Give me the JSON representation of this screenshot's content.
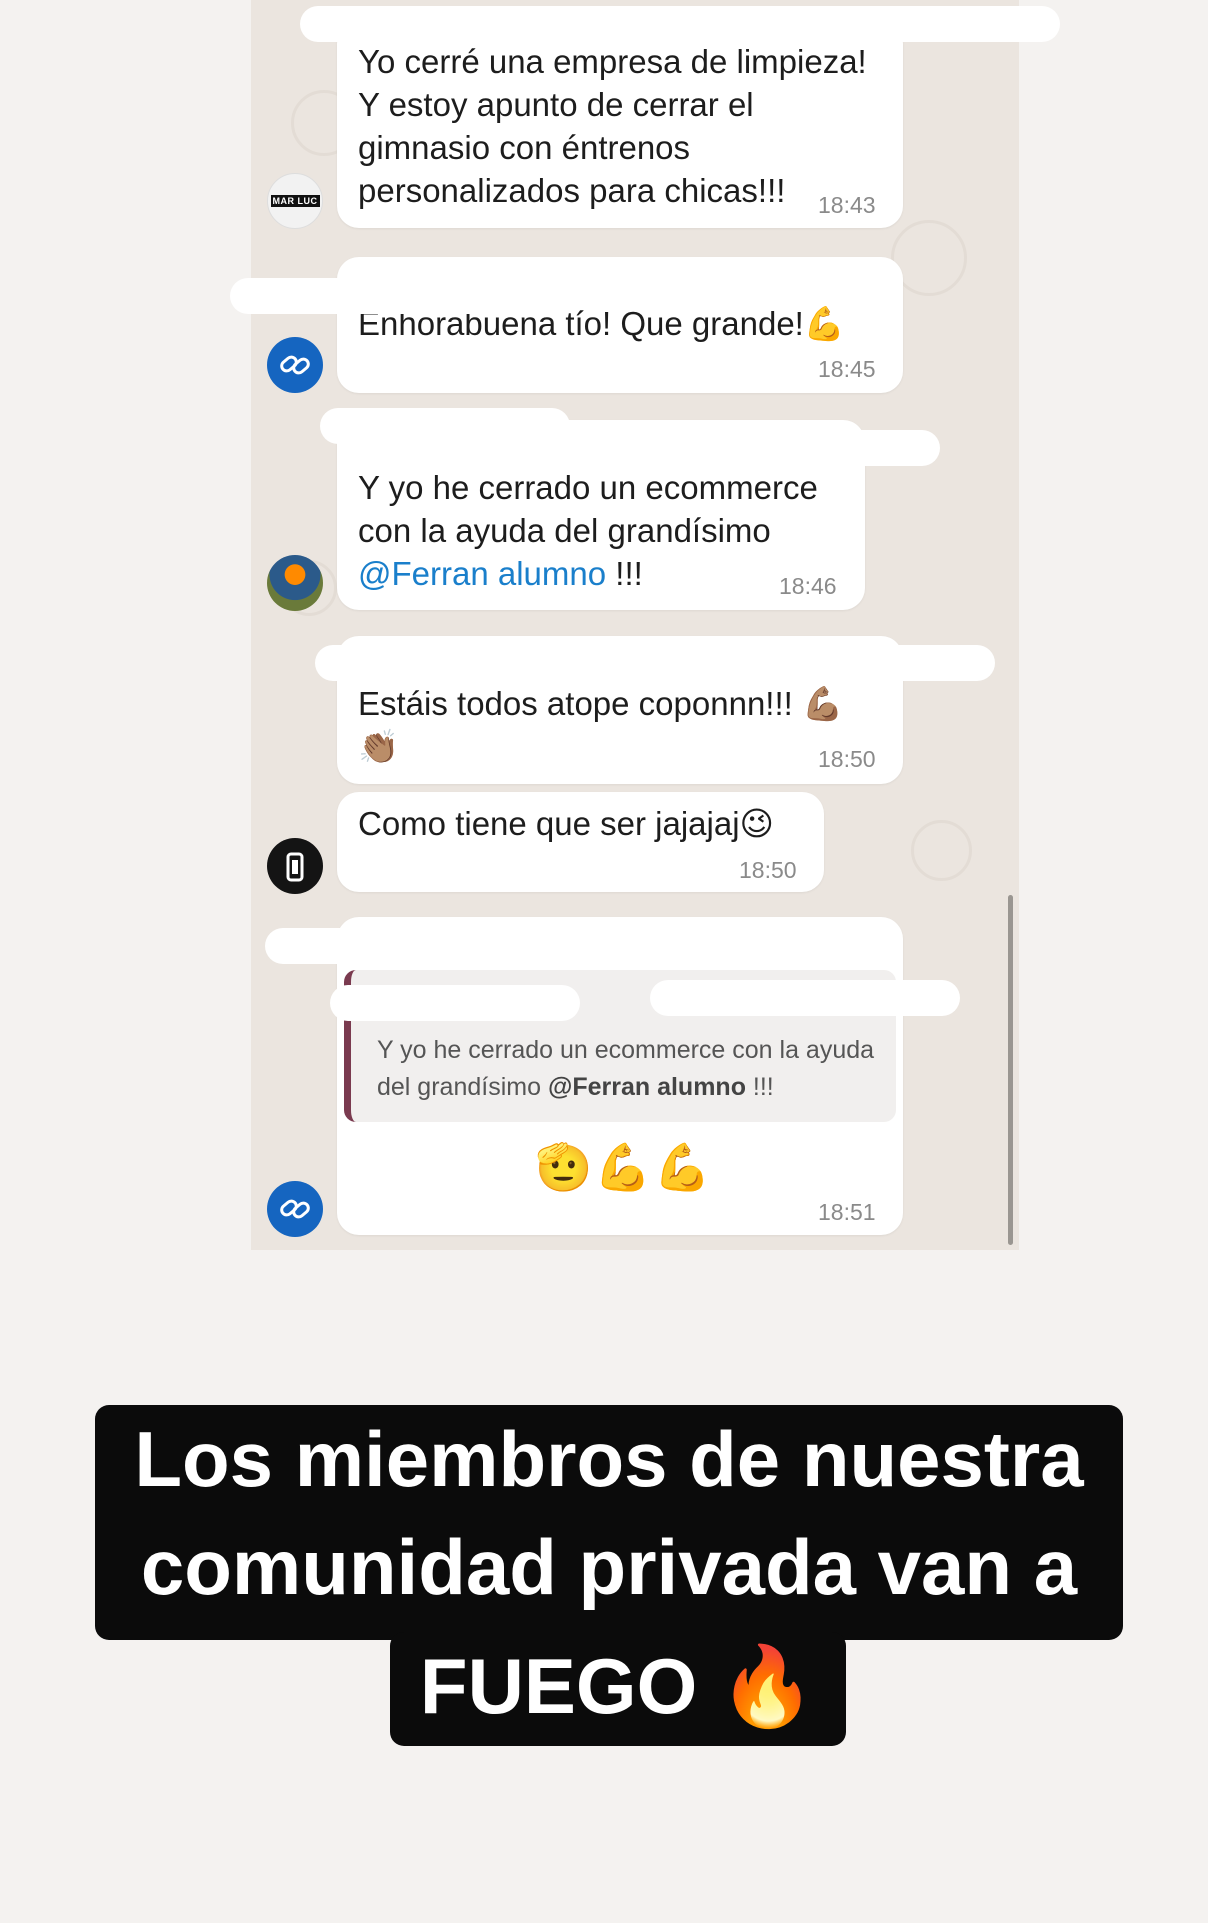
{
  "messages": [
    {
      "text": "Yo cerré una empresa de limpieza!\nY estoy apunto de cerrar el\ngimnasio con éntrenos\npersonalizados para chicas!!!",
      "time": "18:43",
      "avatar": "MAR LUC"
    },
    {
      "text": "Enhorabuena tío! Que grande!💪",
      "time": "18:45"
    },
    {
      "text_before": "Y yo he cerrado un ecommerce\ncon la ayuda del grandísimo\n",
      "mention": "@Ferran alumno",
      "text_after": " !!!",
      "time": "18:46"
    },
    {
      "text": "Estáis todos atope coponnn!!! 💪🏽\n👏🏽",
      "time": "18:50"
    },
    {
      "text": "Como tiene que ser jajajaj😉",
      "time": "18:50"
    },
    {
      "quote_before": "Y yo he cerrado un ecommerce con la ayuda del grandísimo ",
      "quote_mention": "@Ferran alumno",
      "quote_after": " !!!",
      "emojis": "🫡💪💪",
      "time": "18:51"
    }
  ],
  "caption": {
    "line1": "Los miembros de nuestra",
    "line2": "comunidad privada van a",
    "line3": "FUEGO 🔥"
  },
  "colors": {
    "chat_bg": "#ebe5df",
    "mention": "#1a7fcb",
    "caption_bg": "#0b0b0b",
    "quote_bar": "#7a3a4f"
  }
}
